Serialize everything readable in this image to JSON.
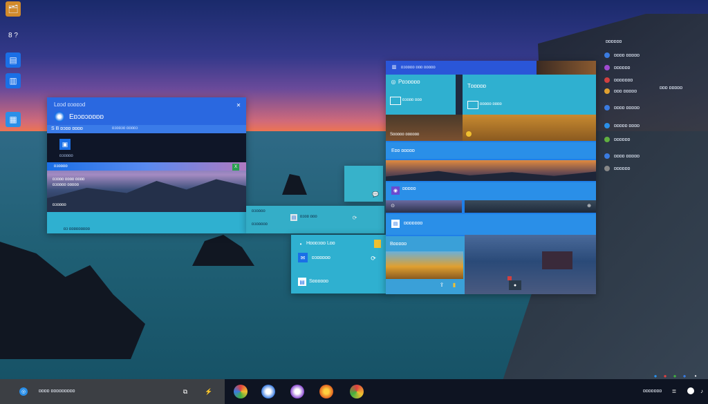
{
  "colors": {
    "accent": "#1a6fe6",
    "accent2": "#2a8fe8",
    "teal": "#2fb0d0",
    "dark": "#0f1628"
  },
  "desktop": {
    "icons": [
      {
        "name": "folder-icon",
        "glyph": "🗂",
        "label": ""
      },
      {
        "name": "app-icon",
        "glyph": "▣",
        "label": "8 ?"
      },
      {
        "name": "store-icon",
        "glyph": "▤",
        "label": ""
      },
      {
        "name": "chat-icon",
        "glyph": "▥",
        "label": ""
      },
      {
        "name": "photo-icon",
        "glyph": "▦",
        "label": ""
      }
    ]
  },
  "left_window": {
    "title": "Lɒɔd ɒɔɒɒɔd",
    "header_title": "Eɒɔɒɔɒɒɒɒ",
    "toolbar_text": "S  B  ɒɔɒɒ ɒɒɒɒ",
    "toolbar_small": "ɒɔɒɒɔɒ ɒɒɒɒɔ",
    "tile_label": "ɒɔɒɒɒɒ",
    "image_title": "ɒɔɒɒɒɒ",
    "image_line1": "ɒɔɒɒɒ ɒɒɒɒ ɒɒɒɒ",
    "image_line2": "ɒɔɒɒɒɒ ɒɒɒɒɒ",
    "footer": "ɒɔ ɒɒɒɒɒɒɒɒɒ"
  },
  "mid_small": {
    "label1": "ɒɔɒɒɒɒ",
    "label2": "ɒɔɒɒ ɒɒɒ",
    "label3": "ɒɔɒɒɒɒɒ"
  },
  "lower_panel": {
    "title": "Hɒɒɒɔɒɒ Lɒɒ",
    "row1": "ɒɔɒɒɒɒɒ",
    "row2": "Sɒɒɒɒɒɒ"
  },
  "right_window": {
    "title": "ɒɔɒɒɒɒ ɒɒɒ ɒɒɒɒɒ",
    "tile1_title": "Pɒɔɒɒɒɒ",
    "tile1_sub": "ɒɔɒɒɒ ɒɒɒ",
    "tile2_title": "Tɒɒɒɒɒ",
    "tile2_sub": "ɒɒɒɒɒ ɒɒɒɒ",
    "tile3_label": "Sɒɒɒɒɒ ɒɒɒɒɒɒ",
    "section1": "Eɒɒ ɒɒɒɒɒ",
    "section2": "ɒɒɒɒɒ",
    "section3": "ɒɒɒɒɒɒɒ",
    "bottom_label": "Bɒɒɒɒɒ"
  },
  "right_rail": {
    "header": "ɒɒɒɒɒɒ",
    "items": [
      {
        "label": "ɒɒɒɒ ɒɒɒɒɒ",
        "color": "#3a7be0"
      },
      {
        "label": "ɒɒɒɒɒɒ",
        "color": "#a04ad0"
      },
      {
        "label": "ɒɒɒɒɒɒɒ",
        "color": "#d04040"
      },
      {
        "label": "ɒɒɒ ɒɒɒɒɒ",
        "color": "#e0a030"
      },
      {
        "label": "ɒɒɒɒ ɒɒɒɒɒ",
        "color": "#3a7be0"
      },
      {
        "label": "ɒɒɒɒɒ ɒɒɒɒ",
        "color": "#2a8fe8"
      },
      {
        "label": "ɒɒɒɒɒɒ",
        "color": "#60b040"
      },
      {
        "label": "ɒɒɒɒ ɒɒɒɒɒ",
        "color": "#3a7be0"
      },
      {
        "label": "ɒɒɒɒɒɒ",
        "color": "#888888"
      }
    ],
    "side_label": "ɒɒɒ ɒɒɒɒɒ"
  },
  "taskbar": {
    "search_text": "ɒɒɒɒ ɒɒɒɒɒɒɒɒɒ",
    "icons": [
      "maps-icon",
      "compass-icon",
      "browser-icon",
      "firefox-icon",
      "chrome-icon"
    ],
    "tray_text": "ɒɒɒɒɒɒɒ"
  }
}
